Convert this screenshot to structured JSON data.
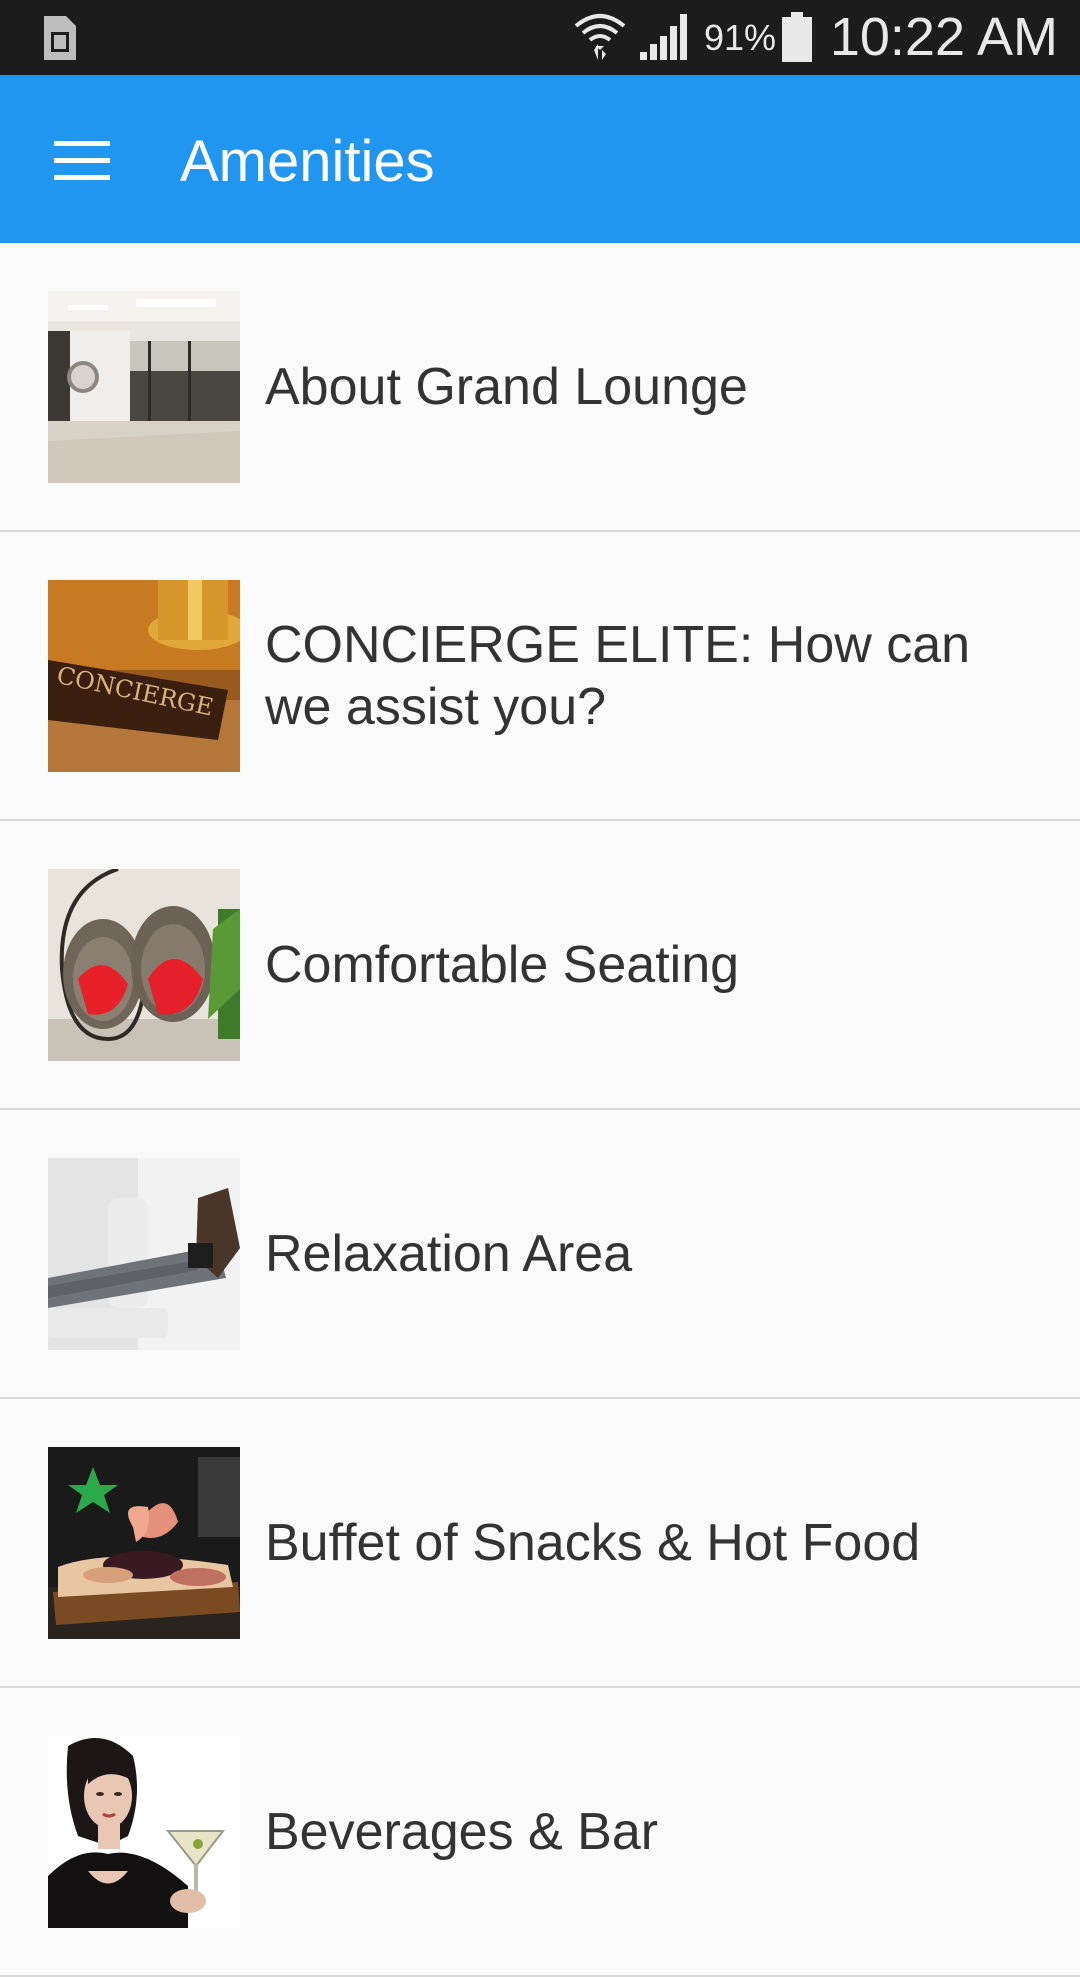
{
  "status_bar": {
    "battery_percent": "91%",
    "time": "10:22 AM",
    "icons": [
      "sim-card-icon",
      "wifi-icon",
      "cell-signal-icon",
      "battery-icon"
    ]
  },
  "app_bar": {
    "title": "Amenities",
    "menu_icon": "hamburger-menu-icon",
    "color": "#2196f0"
  },
  "amenities": [
    {
      "label": "About Grand Lounge",
      "image": "lounge-lobby-photo"
    },
    {
      "label": "CONCIERGE ELITE: How can we assist you?",
      "image": "concierge-desk-sign-photo"
    },
    {
      "label": "Comfortable Seating",
      "image": "hanging-egg-chairs-photo"
    },
    {
      "label": "Relaxation Area",
      "image": "reclined-legs-photo"
    },
    {
      "label": "Buffet of Snacks & Hot Food",
      "image": "buffet-platter-photo"
    },
    {
      "label": "Beverages & Bar",
      "image": "woman-with-martini-photo"
    }
  ]
}
